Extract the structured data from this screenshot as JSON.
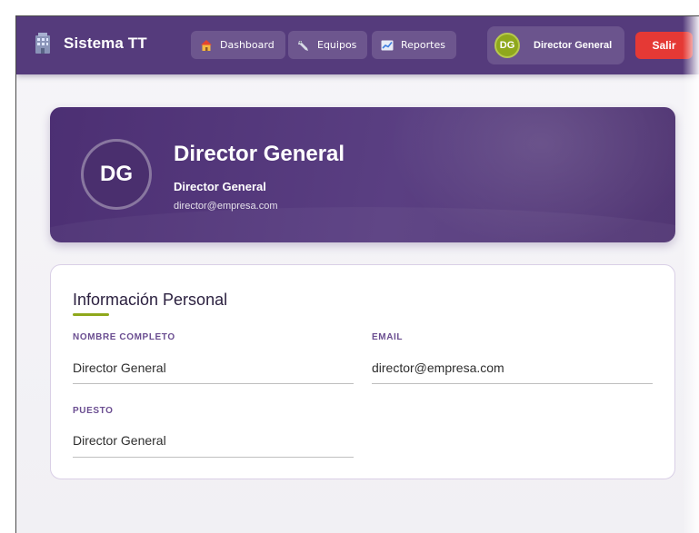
{
  "brand": {
    "title": "Sistema TT",
    "icon": "building-icon"
  },
  "nav": [
    {
      "label": "Dashboard",
      "icon": "house-icon"
    },
    {
      "label": "Equipos",
      "icon": "wrench-icon"
    },
    {
      "label": "Reportes",
      "icon": "chart-icon"
    }
  ],
  "user": {
    "initials": "DG",
    "name": "Director General"
  },
  "logout": {
    "label": "Salir"
  },
  "profile": {
    "initials": "DG",
    "name": "Director General",
    "role": "Director General",
    "email": "director@empresa.com"
  },
  "info": {
    "title": "Información Personal",
    "fields": {
      "full_name": {
        "label": "NOMBRE COMPLETO",
        "value": "Director General"
      },
      "email": {
        "label": "EMAIL",
        "value": "director@empresa.com"
      },
      "position": {
        "label": "PUESTO",
        "value": "Director General"
      }
    }
  },
  "colors": {
    "navbar": "#553b7c",
    "accent": "#8fa81c",
    "logout": "#e53935",
    "label": "#6b4e91"
  }
}
